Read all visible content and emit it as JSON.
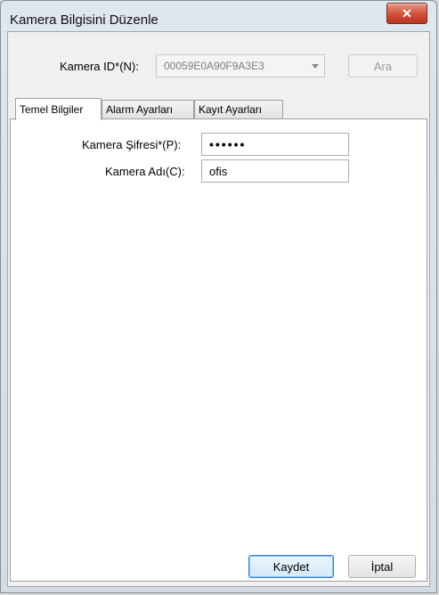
{
  "window": {
    "title": "Kamera Bilgisini Düzenle",
    "close_glyph": "✕"
  },
  "camera_id": {
    "label": "Kamera ID*(N):",
    "value": "00059E0A90F9A3E3",
    "search_button": "Ara"
  },
  "tabs": [
    {
      "label": "Temel Bilgiler",
      "active": true
    },
    {
      "label": "Alarm Ayarları",
      "active": false
    },
    {
      "label": "Kayıt Ayarları",
      "active": false
    }
  ],
  "basic": {
    "password_label": "Kamera Şifresi*(P):",
    "password_value": "••••••",
    "name_label": "Kamera Adı(C):",
    "name_value": "ofis"
  },
  "buttons": {
    "save": "Kaydet",
    "cancel": "İptal"
  }
}
